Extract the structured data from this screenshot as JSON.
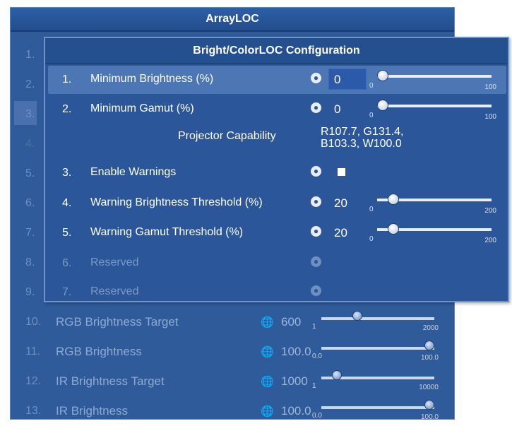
{
  "background": {
    "title": "ArrayLOC",
    "rows": [
      {
        "num": "1."
      },
      {
        "num": "2."
      },
      {
        "num": "3."
      },
      {
        "num": "4."
      },
      {
        "num": "5."
      },
      {
        "num": "6."
      },
      {
        "num": "7."
      },
      {
        "num": "8."
      },
      {
        "num": "9."
      },
      {
        "num": "10.",
        "label": "RGB Brightness Target",
        "value": "600",
        "min": "1",
        "max": "2000",
        "level": 0.3
      },
      {
        "num": "11.",
        "label": "RGB Brightness",
        "value": "100.0",
        "min": "0.0",
        "max": "100.0",
        "level": 1.0
      },
      {
        "num": "12.",
        "label": "IR Brightness Target",
        "value": "1000",
        "min": "1",
        "max": "10000",
        "level": 0.1
      },
      {
        "num": "13.",
        "label": "IR Brightness",
        "value": "100.0",
        "min": "0.0",
        "max": "100.0",
        "level": 1.0
      }
    ]
  },
  "dialog": {
    "title": "Bright/ColorLOC Configuration",
    "rows": [
      {
        "num": "1.",
        "label": "Minimum Brightness (%)",
        "value": "0",
        "min": "0",
        "max": "100",
        "level": 0.0
      },
      {
        "num": "2.",
        "label": "Minimum Gamut (%)",
        "value": "0",
        "min": "0",
        "max": "100",
        "level": 0.0
      },
      {
        "label": "Projector Capability",
        "value_line1": "R107.7, G131.4,",
        "value_line2": "B103.3, W100.0"
      },
      {
        "num": "3.",
        "label": "Enable Warnings",
        "checked": true
      },
      {
        "num": "4.",
        "label": "Warning Brightness Threshold (%)",
        "value": "20",
        "min": "0",
        "max": "200",
        "level": 0.1
      },
      {
        "num": "5.",
        "label": "Warning Gamut Threshold (%)",
        "value": "20",
        "min": "0",
        "max": "200",
        "level": 0.1
      },
      {
        "num": "6.",
        "label": "Reserved"
      },
      {
        "num": "7.",
        "label": "Reserved"
      }
    ],
    "globe_icon": "globe-icon"
  }
}
